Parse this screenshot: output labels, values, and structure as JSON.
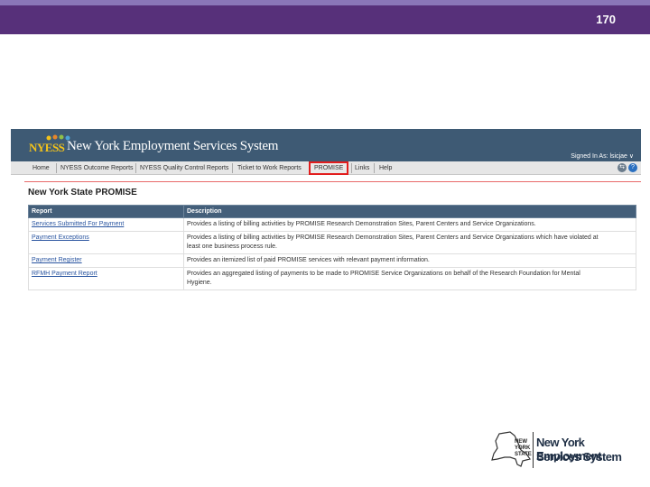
{
  "slide": {
    "number": "170"
  },
  "app": {
    "logo_text": "NYESS",
    "title": "New York Employment Services System",
    "signed_in": "Signed In As: lsicjae ∨"
  },
  "nav": {
    "items": [
      "Home",
      "NYESS Outcome Reports",
      "NYESS Quality Control Reports",
      "Ticket to Work Reports",
      "PROMISE",
      "Links",
      "Help"
    ],
    "icons": [
      "exit-icon",
      "help-icon"
    ]
  },
  "page": {
    "title": "New York State PROMISE"
  },
  "table": {
    "headers": [
      "Report",
      "Description"
    ],
    "rows": [
      {
        "report": "Services Submitted For Payment",
        "description_lines": [
          "Provides a listing of billing activities by PROMISE Research Demonstration Sites, Parent Centers and Service Organizations."
        ]
      },
      {
        "report": "Payment Exceptions",
        "description_lines": [
          "Provides a listing of billing activities by PROMISE Research Demonstration Sites, Parent Centers and Service Organizations which have violated at",
          "least one business process rule."
        ]
      },
      {
        "report": "Payment Register",
        "description_lines": [
          "Provides an itemized list of paid PROMISE services with relevant payment information."
        ]
      },
      {
        "report": "RFMH Payment Report",
        "description_lines": [
          "Provides an aggregated listing of payments to be made to PROMISE Service Organizations on behalf of the Research Foundation for Mental",
          "Hygiene."
        ]
      }
    ]
  },
  "footer_logo": {
    "state_words": [
      "NEW",
      "YORK",
      "STATE"
    ],
    "line1": "New York Employment",
    "line2": "Services System"
  },
  "colors": {
    "slide_header": "#57307a",
    "app_header": "#3e5a74",
    "table_header": "#445f7a",
    "highlight": "#e21d1d",
    "link": "#2a55a0"
  }
}
